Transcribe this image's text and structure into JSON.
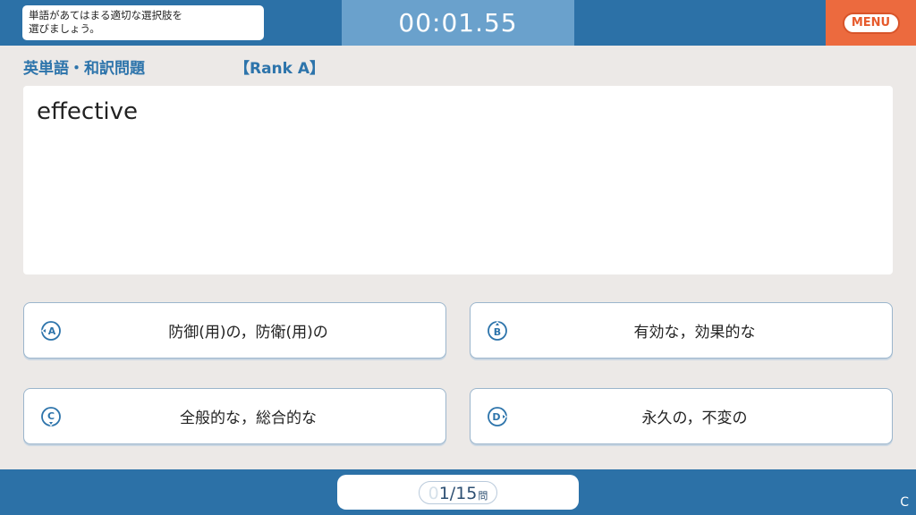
{
  "header": {
    "instruction": "単語があてはまる適切な選択肢を\n選びましょう。",
    "timer": "00:01.55",
    "menu_label": "MENU"
  },
  "quiz": {
    "category": "英単語・和訳問題",
    "rank": "【Rank A】",
    "question_word": "effective"
  },
  "choices": [
    {
      "letter": "A",
      "label": "防御(用)の，防衛(用)の"
    },
    {
      "letter": "B",
      "label": "有効な，効果的な"
    },
    {
      "letter": "C",
      "label": "全般的な，総合的な"
    },
    {
      "letter": "D",
      "label": "永久の，不変の"
    }
  ],
  "footer": {
    "progress_ghost": "0",
    "progress_current": "1",
    "progress_sep": "/",
    "progress_total": "15",
    "progress_unit": "問",
    "corner_glyph": "C"
  },
  "colors": {
    "primary_blue": "#2c71a7",
    "timer_blue": "#6aa1cc",
    "menu_orange": "#ec6a3e",
    "background": "#ece9e7"
  }
}
